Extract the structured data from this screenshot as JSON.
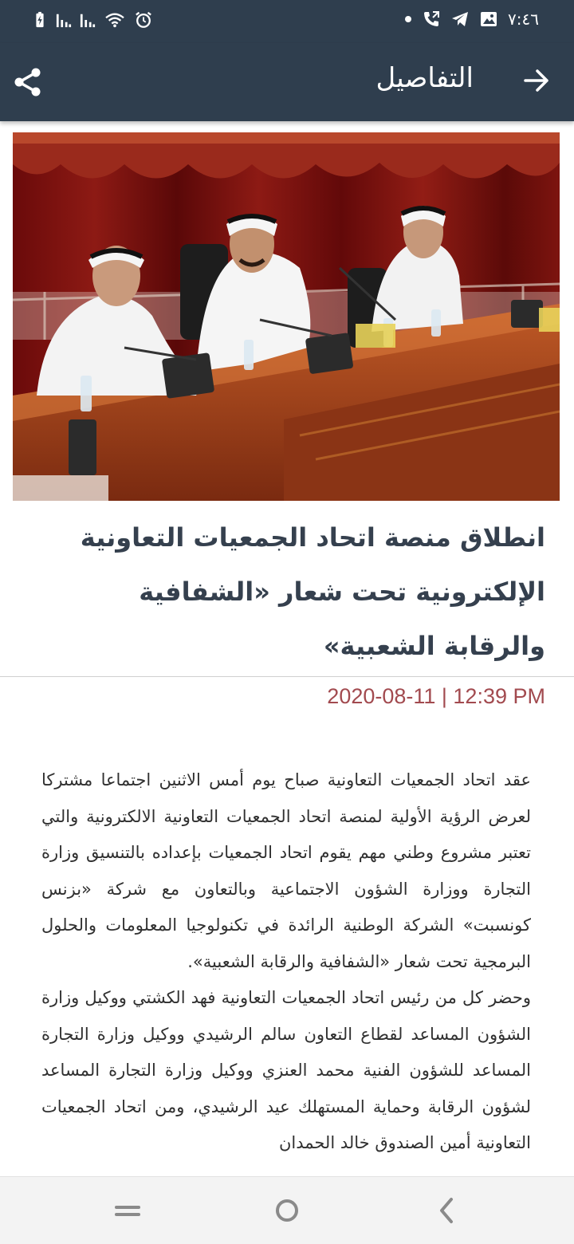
{
  "status_bar": {
    "time": "٧:٤٦",
    "colors": {
      "background": "#2f3e4e",
      "icons": "#ffffff"
    },
    "icons": [
      "battery-charging-icon",
      "signal-icon",
      "signal-icon",
      "wifi-icon",
      "alarm-icon",
      "dot-icon",
      "call-forward-icon",
      "telegram-icon",
      "gallery-icon"
    ]
  },
  "app_bar": {
    "title": "التفاصيل",
    "back_icon": "arrow-right-icon",
    "share_icon": "share-icon"
  },
  "article": {
    "image_description_icon": "meeting-photo",
    "headline": "انطلاق منصة اتحاد الجمعيات التعاونية الإلكترونية تحت شعار «الشفافية والرقابة الشعبية»",
    "datetime": "2020-08-11 | 12:39 PM",
    "paragraph_1": "عقد اتحاد الجمعيات التعاونية صباح يوم أمس الاثنين اجتماعا مشتركا لعرض الرؤية الأولية لمنصة اتحاد الجمعيات التعاونية الالكترونية والتي تعتبر مشروع وطني مهم يقوم اتحاد الجمعيات بإعداده بالتنسيق وزارة التجارة ووزارة الشؤون الاجتماعية وبالتعاون مع شركة «بزنس كونسبت» الشركة الوطنية الرائدة في تكنولوجيا المعلومات والحلول البرمجية تحت شعار «الشفافية والرقابة الشعبية».",
    "paragraph_2": "وحضر كل من رئيس اتحاد الجمعيات التعاونية فهد الكشتي ووكيل وزارة الشؤون المساعد لقطاع التعاون سالم الرشيدي ووكيل وزارة التجارة المساعد للشؤون الفنية محمد العنزي ووكيل وزارة التجارة المساعد لشؤون الرقابة وحماية المستهلك عيد الرشيدي، ومن اتحاد الجمعيات التعاونية أمين الصندوق خالد الحمدان",
    "colors": {
      "headline": "#35404e",
      "date": "#a24a4f",
      "body": "#303030"
    }
  },
  "nav_bar": {
    "buttons": [
      "recent-apps-icon",
      "home-icon",
      "back-icon"
    ]
  }
}
